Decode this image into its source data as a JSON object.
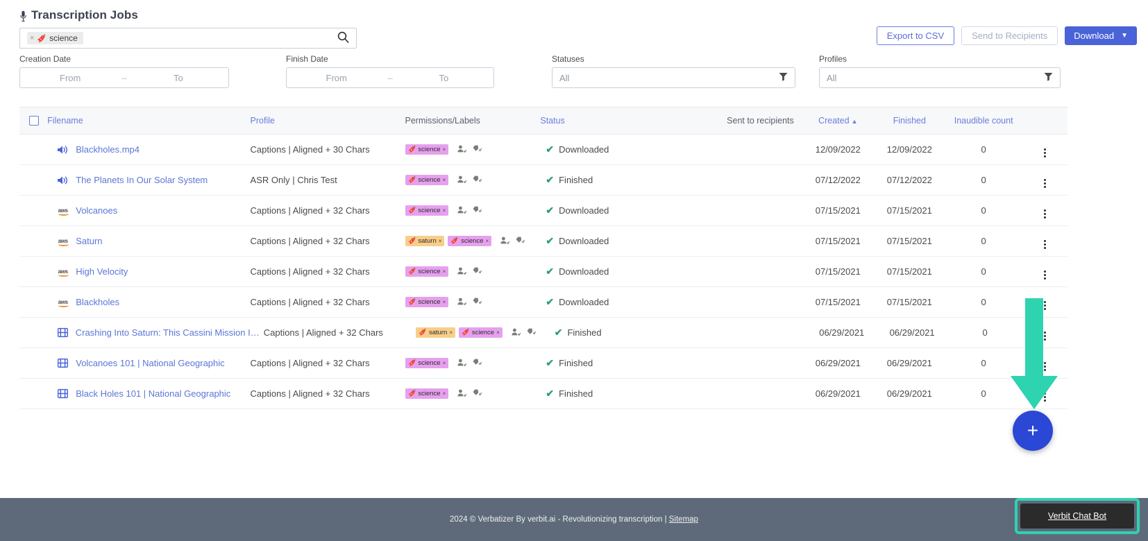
{
  "header": {
    "title": "Transcription Jobs",
    "mic_icon": "microphone-icon"
  },
  "search": {
    "chip_label": "science",
    "chip_remove": "×",
    "tag_icon": "tag-icon",
    "search_icon": "🔍",
    "placeholder": ""
  },
  "toolbar": {
    "export_csv": "Export to CSV",
    "send_to_recipients": "Send to Recipients",
    "download": "Download",
    "download_caret": "⌄"
  },
  "filters": {
    "creation_date": {
      "label": "Creation Date",
      "from": "From",
      "to": "To",
      "dash": "–"
    },
    "finish_date": {
      "label": "Finish Date",
      "from": "From",
      "to": "To",
      "dash": "–"
    },
    "statuses": {
      "label": "Statuses",
      "value": "All",
      "icon": "filter-funnel-icon"
    },
    "profiles": {
      "label": "Profiles",
      "value": "All",
      "icon": "filter-funnel-icon"
    }
  },
  "table": {
    "columns": {
      "filename": "Filename",
      "profile": "Profile",
      "permissions": "Permissions/Labels",
      "status": "Status",
      "sent": "Sent to recipients",
      "created": "Created",
      "created_sort": "▲",
      "finished": "Finished",
      "inaudible": "Inaudible count"
    },
    "rows": [
      {
        "icon": "speaker-icon",
        "icon_type": "speaker",
        "filename": "Blackholes.mp4",
        "profile": "Captions | Aligned + 30 Chars",
        "labels": [
          {
            "text": "science",
            "color": "science"
          }
        ],
        "status": "Downloaded",
        "sent": "",
        "created": "12/09/2022",
        "finished": "12/09/2022",
        "inaudible": "0"
      },
      {
        "icon": "speaker-icon",
        "icon_type": "speaker",
        "filename": "The Planets In Our Solar System",
        "profile": "ASR Only | Chris Test",
        "labels": [
          {
            "text": "science",
            "color": "science"
          }
        ],
        "status": "Finished",
        "sent": "",
        "created": "07/12/2022",
        "finished": "07/12/2022",
        "inaudible": "0"
      },
      {
        "icon": "aws-icon",
        "icon_type": "aws",
        "filename": "Volcanoes",
        "profile": "Captions | Aligned + 32 Chars",
        "labels": [
          {
            "text": "science",
            "color": "science"
          }
        ],
        "status": "Downloaded",
        "sent": "",
        "created": "07/15/2021",
        "finished": "07/15/2021",
        "inaudible": "0"
      },
      {
        "icon": "aws-icon",
        "icon_type": "aws",
        "filename": "Saturn",
        "profile": "Captions | Aligned + 32 Chars",
        "labels": [
          {
            "text": "saturn",
            "color": "saturn"
          },
          {
            "text": "science",
            "color": "science"
          }
        ],
        "status": "Downloaded",
        "sent": "",
        "created": "07/15/2021",
        "finished": "07/15/2021",
        "inaudible": "0"
      },
      {
        "icon": "aws-icon",
        "icon_type": "aws",
        "filename": "High Velocity",
        "profile": "Captions | Aligned + 32 Chars",
        "labels": [
          {
            "text": "science",
            "color": "science"
          }
        ],
        "status": "Downloaded",
        "sent": "",
        "created": "07/15/2021",
        "finished": "07/15/2021",
        "inaudible": "0"
      },
      {
        "icon": "aws-icon",
        "icon_type": "aws",
        "filename": "Blackholes",
        "profile": "Captions | Aligned + 32 Chars",
        "labels": [
          {
            "text": "science",
            "color": "science"
          }
        ],
        "status": "Downloaded",
        "sent": "",
        "created": "07/15/2021",
        "finished": "07/15/2021",
        "inaudible": "0"
      },
      {
        "icon": "film-icon",
        "icon_type": "film",
        "filename": "Crashing Into Saturn: This Cassini Mission Is the …howcase",
        "profile": "Captions | Aligned + 32 Chars",
        "labels": [
          {
            "text": "saturn",
            "color": "saturn"
          },
          {
            "text": "science",
            "color": "science"
          }
        ],
        "status": "Finished",
        "sent": "",
        "created": "06/29/2021",
        "finished": "06/29/2021",
        "inaudible": "0"
      },
      {
        "icon": "film-icon",
        "icon_type": "film",
        "filename": "Volcanoes 101 | National Geographic",
        "profile": "Captions | Aligned + 32 Chars",
        "labels": [
          {
            "text": "science",
            "color": "science"
          }
        ],
        "status": "Finished",
        "sent": "",
        "created": "06/29/2021",
        "finished": "06/29/2021",
        "inaudible": "0"
      },
      {
        "icon": "film-icon",
        "icon_type": "film",
        "filename": "Black Holes 101 | National Geographic",
        "profile": "Captions | Aligned + 32 Chars",
        "labels": [
          {
            "text": "science",
            "color": "science"
          }
        ],
        "status": "Finished",
        "sent": "",
        "created": "06/29/2021",
        "finished": "06/29/2021",
        "inaudible": "0"
      }
    ]
  },
  "fab": {
    "label": "+"
  },
  "annotation": {
    "arrow_color": "#2ed3b0"
  },
  "footer": {
    "text": "2024 © Verbatizer By verbit.ai - Revolutionizing transcription | ",
    "sitemap": "Sitemap",
    "chatbot_label": "Verbit Chat Bot"
  },
  "colors": {
    "accent": "#4a63d8",
    "link": "#5b76d6",
    "success": "#2e9e7e",
    "chip_science": "#e6a0ee",
    "chip_saturn": "#f8ce8a",
    "footer_bg": "#5e6a7a",
    "teal": "#2ed3b0"
  }
}
